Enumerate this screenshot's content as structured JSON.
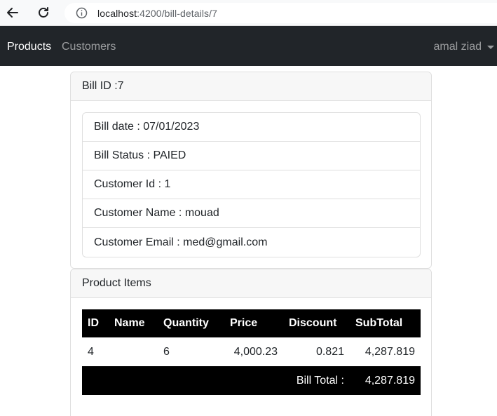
{
  "browser": {
    "url_host": "localhost",
    "url_path": ":4200/bill-details/7"
  },
  "navbar": {
    "products": "Products",
    "customers": "Customers",
    "user": "amal ziad"
  },
  "bill": {
    "header": "Bill ID :7",
    "date": "Bill date : 07/01/2023",
    "status": "Bill Status : PAIED",
    "customer_id": "Customer Id : 1",
    "customer_name": "Customer Name : mouad",
    "customer_email": "Customer Email : med@gmail.com"
  },
  "items": {
    "header": "Product Items",
    "columns": [
      "ID",
      "Name",
      "Quantity",
      "Price",
      "Discount",
      "SubTotal"
    ],
    "rows": [
      {
        "id": "4",
        "name": "",
        "quantity": "6",
        "price": "4,000.23",
        "discount": "0.821",
        "subtotal": "4,287.819"
      }
    ],
    "total_label": "Bill Total :",
    "total_value": "4,287.819"
  }
}
